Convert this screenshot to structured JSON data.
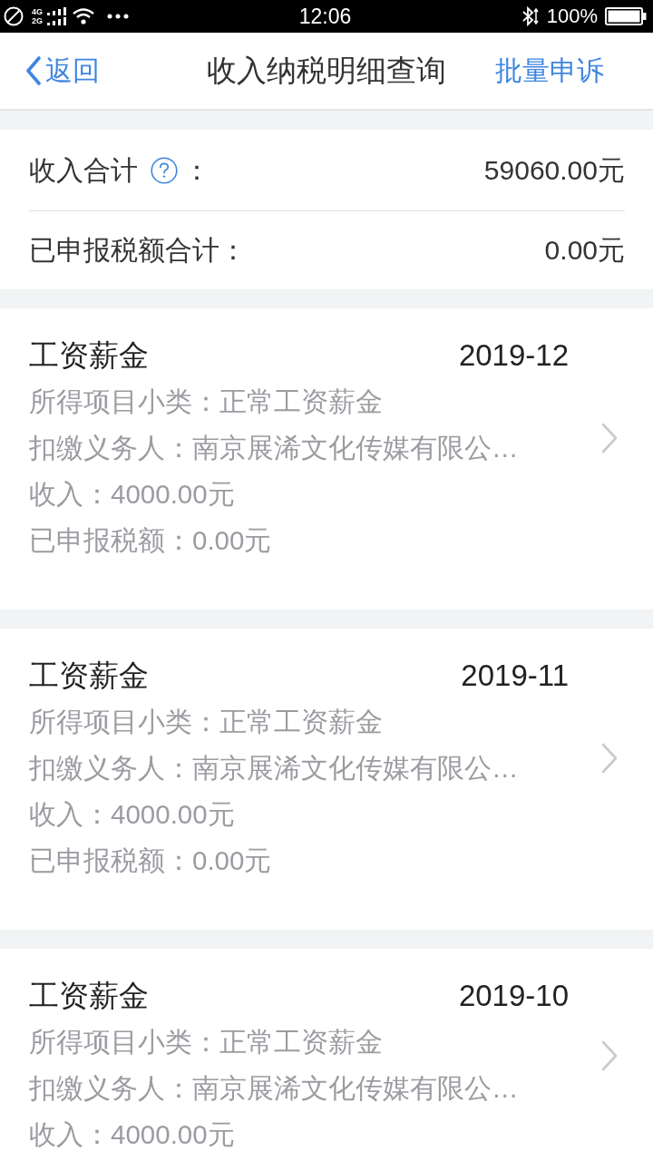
{
  "status_bar": {
    "network_labels": [
      "4G",
      "2G"
    ],
    "time": "12:06",
    "battery": "100%"
  },
  "nav_bar": {
    "back": "返回",
    "title": "收入纳税明细查询",
    "action": "批量申诉"
  },
  "summary": [
    {
      "kind": "help",
      "label": "收入合计",
      "colon": "：",
      "value": "59060.00元"
    },
    {
      "kind": "plain",
      "label": "已申报税额合计：",
      "value": "0.00元"
    }
  ],
  "records": [
    {
      "title": "工资薪金",
      "period": "2019-12",
      "lines": [
        "所得项目小类：正常工资薪金",
        "扣缴义务人：南京展浠文化传媒有限公…",
        "收入：4000.00元",
        "已申报税额：0.00元"
      ]
    },
    {
      "title": "工资薪金",
      "period": "2019-11",
      "lines": [
        "所得项目小类：正常工资薪金",
        "扣缴义务人：南京展浠文化传媒有限公…",
        "收入：4000.00元",
        "已申报税额：0.00元"
      ]
    },
    {
      "title": "工资薪金",
      "period": "2019-10",
      "lines": [
        "所得项目小类：正常工资薪金",
        "扣缴义务人：南京展浠文化传媒有限公…",
        "收入：4000.00元"
      ]
    }
  ]
}
